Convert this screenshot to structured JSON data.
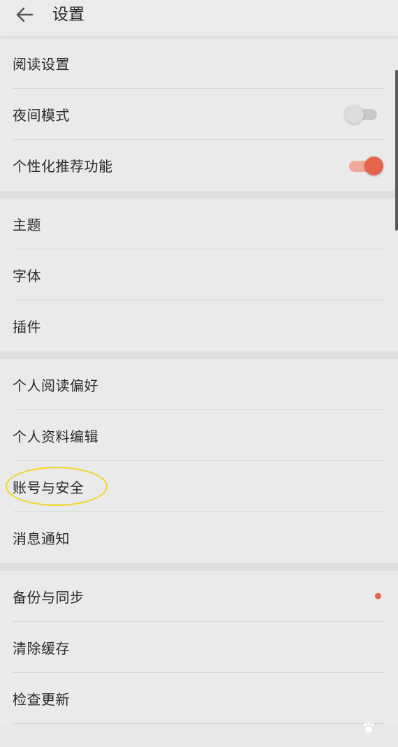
{
  "header": {
    "title": "设置",
    "back_icon": "arrow-left-icon"
  },
  "groups": [
    {
      "items": [
        {
          "label": "阅读设置"
        },
        {
          "label": "夜间模式",
          "control": "toggle",
          "state": "off"
        },
        {
          "label": "个性化推荐功能",
          "control": "toggle",
          "state": "on"
        }
      ]
    },
    {
      "items": [
        {
          "label": "主题"
        },
        {
          "label": "字体"
        },
        {
          "label": "插件"
        }
      ]
    },
    {
      "items": [
        {
          "label": "个人阅读偏好"
        },
        {
          "label": "个人资料编辑"
        },
        {
          "label": "账号与安全",
          "highlighted": true
        },
        {
          "label": "消息通知"
        }
      ]
    },
    {
      "items": [
        {
          "label": "备份与同步",
          "badge": "dot"
        },
        {
          "label": "清除缓存"
        },
        {
          "label": "检查更新"
        }
      ]
    }
  ],
  "colors": {
    "accent": "#e6644c",
    "highlight_ring": "#f3d51e"
  }
}
